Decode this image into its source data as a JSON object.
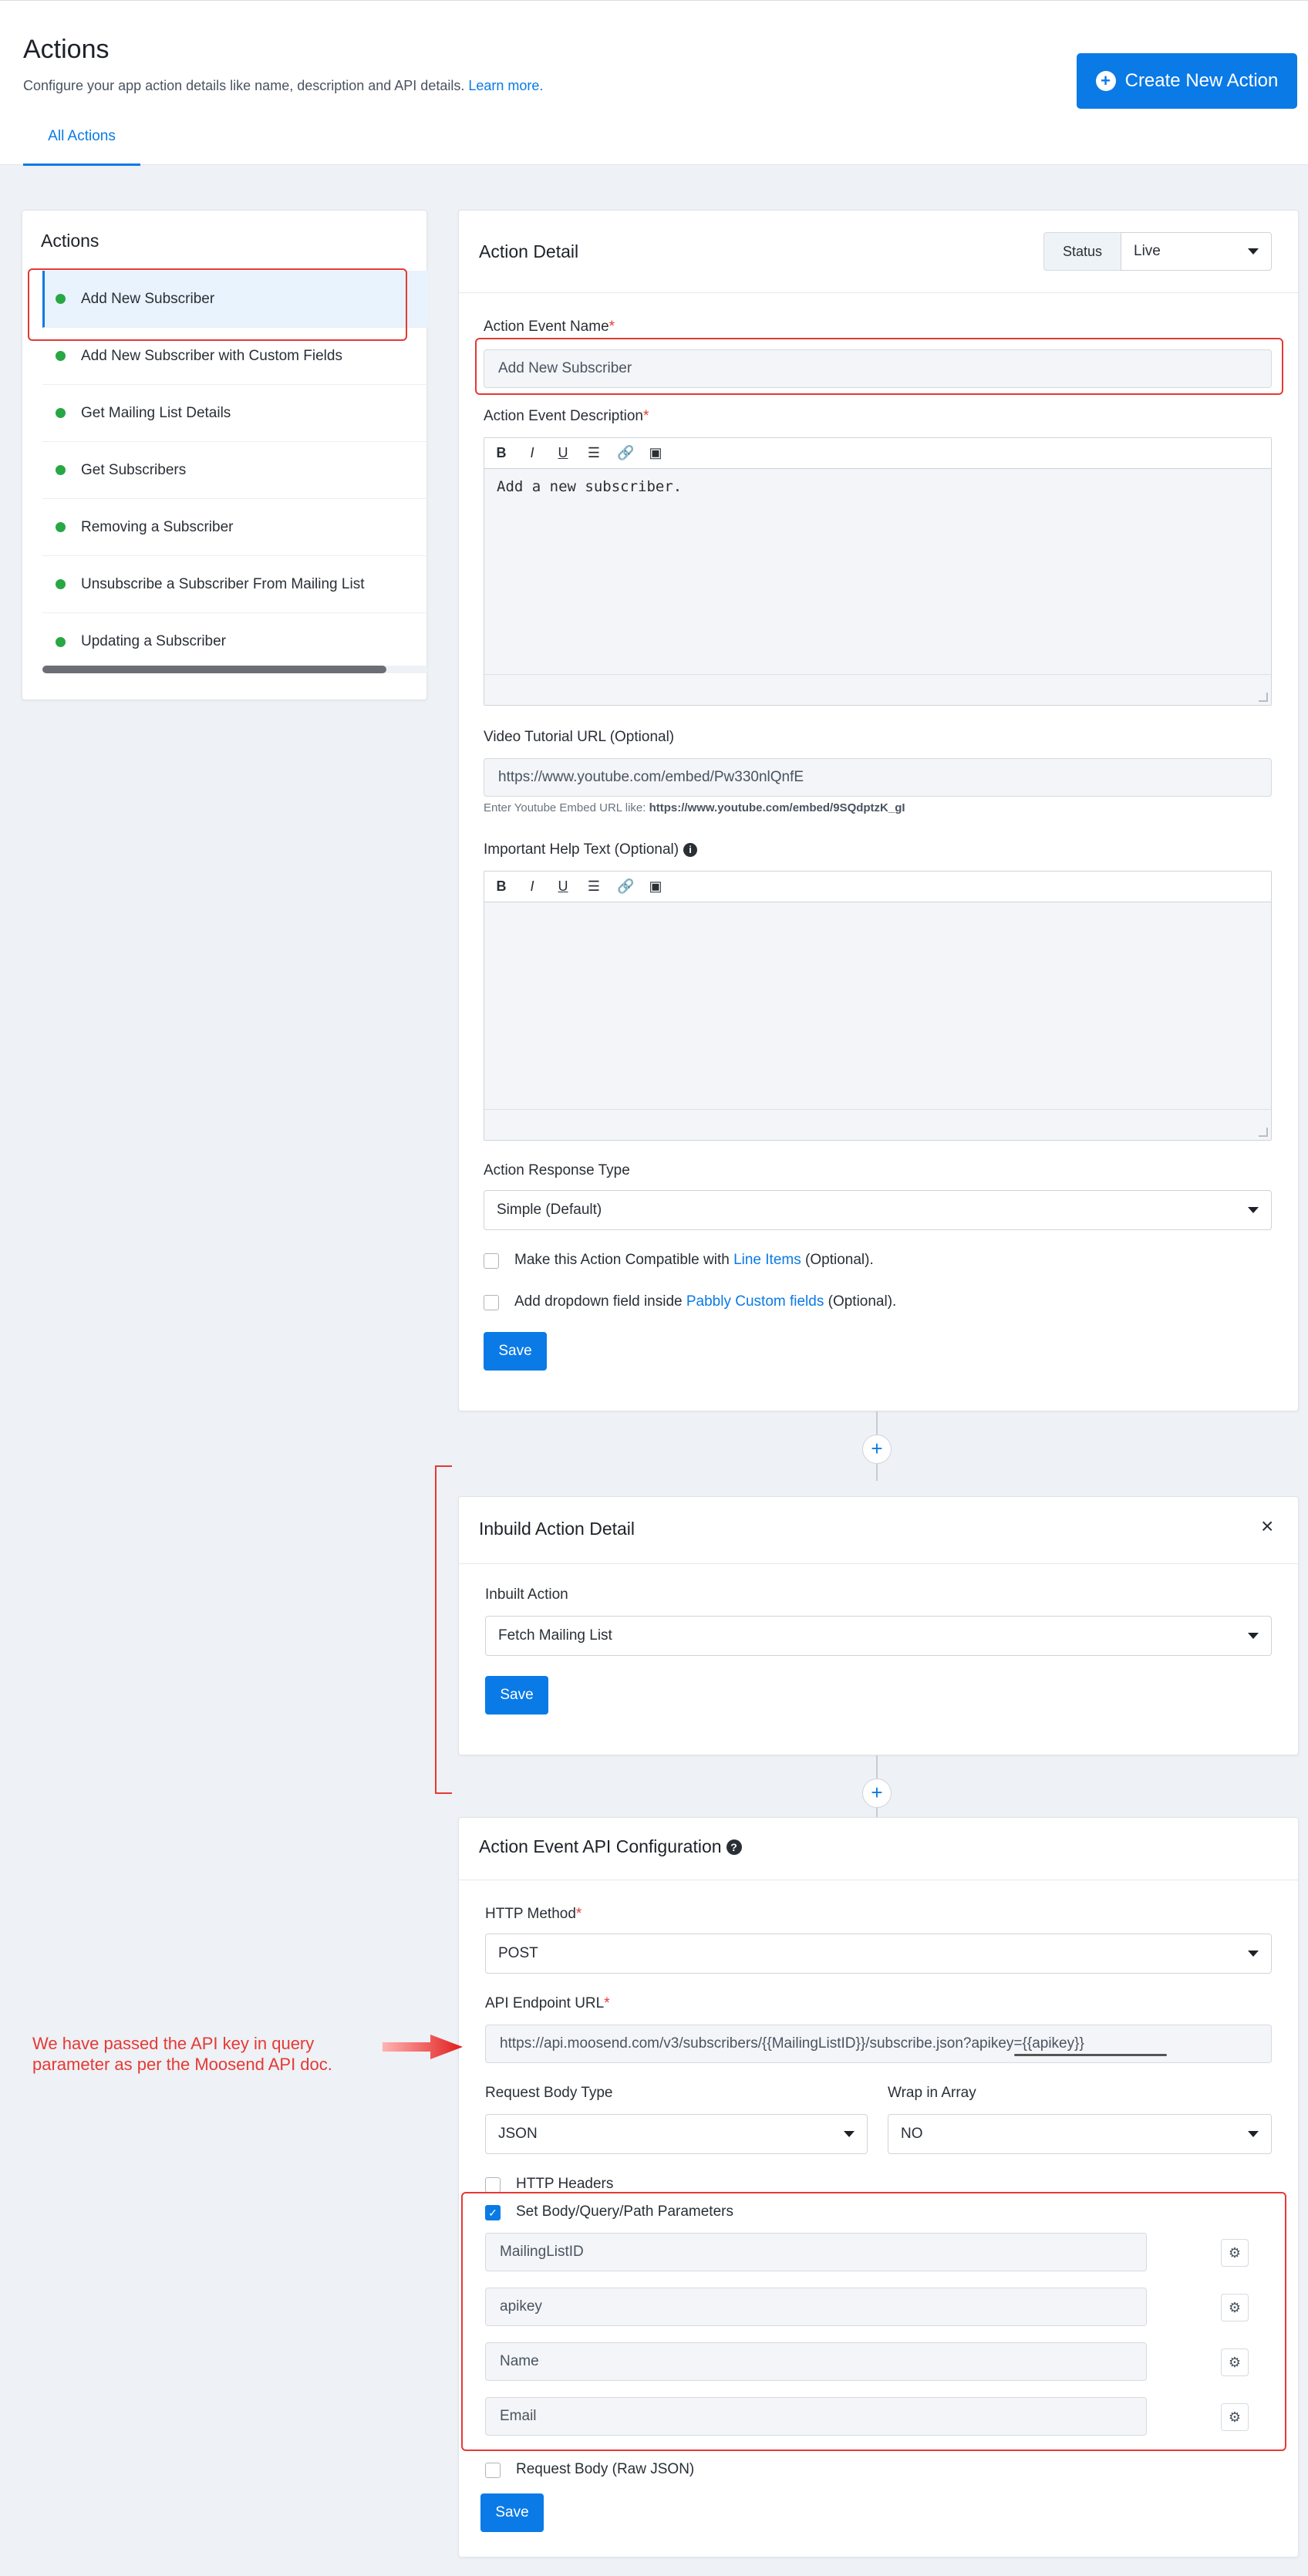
{
  "header": {
    "title": "Actions",
    "subtitle": "Configure your app action details like name, description and API details.",
    "learn_more": "Learn more.",
    "tab_all_actions": "All Actions",
    "create_button": "Create New Action"
  },
  "actions_list": {
    "title": "Actions",
    "items": [
      {
        "label": "Add New Subscriber"
      },
      {
        "label": "Add New Subscriber with Custom Fields"
      },
      {
        "label": "Get Mailing List Details"
      },
      {
        "label": "Get Subscribers"
      },
      {
        "label": "Removing a Subscriber"
      },
      {
        "label": "Unsubscribe a Subscriber From Mailing List"
      },
      {
        "label": "Updating a Subscriber"
      }
    ]
  },
  "action_detail": {
    "title": "Action Detail",
    "status_label": "Status",
    "status_value": "Live",
    "event_name_label": "Action Event Name",
    "event_name_value": "Add New Subscriber",
    "event_desc_label": "Action Event Description",
    "event_desc_value": "Add a new subscriber.",
    "video_label": "Video Tutorial URL (Optional)",
    "video_value": "https://www.youtube.com/embed/Pw330nlQnfE",
    "video_hint_prefix": "Enter Youtube Embed URL like:",
    "video_hint_example": "https://www.youtube.com/embed/9SQdptzK_gI",
    "help_text_label": "Important Help Text (Optional)",
    "response_type_label": "Action Response Type",
    "response_type_value": "Simple (Default)",
    "line_items_prefix": "Make this Action Compatible with",
    "line_items_link": "Line Items",
    "line_items_suffix": "(Optional).",
    "dropdown_prefix": "Add dropdown field inside",
    "dropdown_link": "Pabbly Custom fields",
    "dropdown_suffix": "(Optional).",
    "save": "Save"
  },
  "inbuilt": {
    "title": "Inbuild Action Detail",
    "close": "×",
    "label": "Inbuilt Action",
    "value": "Fetch Mailing List",
    "save": "Save"
  },
  "api_config": {
    "title": "Action Event API Configuration",
    "http_method_label": "HTTP Method",
    "http_method_value": "POST",
    "endpoint_label": "API Endpoint URL",
    "endpoint_value": "https://api.moosend.com/v3/subscribers/{{MailingListID}}/subscribe.json?apikey={{apikey}}",
    "body_type_label": "Request Body Type",
    "body_type_value": "JSON",
    "wrap_label": "Wrap in Array",
    "wrap_value": "NO",
    "http_headers": "HTTP Headers",
    "set_params": "Set Body/Query/Path Parameters",
    "params": [
      "MailingListID",
      "apikey",
      "Name",
      "Email"
    ],
    "raw_json": "Request Body (Raw JSON)",
    "save": "Save"
  },
  "annotation": {
    "line1": "We have passed the API key in query",
    "line2": "parameter as per the Moosend API doc."
  },
  "colors": {
    "accent": "#0a7ae6",
    "status_green": "#28a745",
    "annotation_red": "#e53935"
  }
}
